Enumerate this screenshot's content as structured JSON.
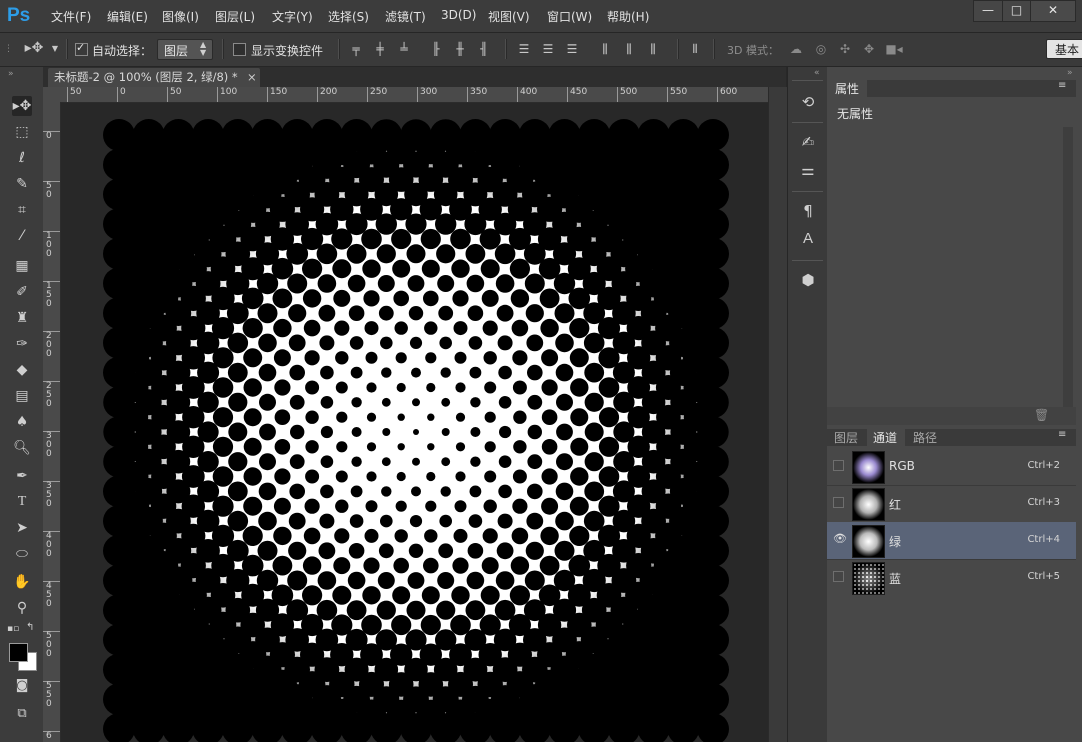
{
  "app": {
    "logo": "Ps"
  },
  "menu": [
    "文件(F)",
    "编辑(E)",
    "图像(I)",
    "图层(L)",
    "文字(Y)",
    "选择(S)",
    "滤镜(T)",
    "3D(D)",
    "视图(V)",
    "窗口(W)",
    "帮助(H)"
  ],
  "window_controls": {
    "minimize": "—",
    "restore": "□",
    "close": "✕"
  },
  "options": {
    "auto_select_label": "自动选择：",
    "auto_select_target": "图层",
    "show_transform_label": "显示变换控件",
    "mode_3d_label": "3D 模式：",
    "workspace_button": "基本"
  },
  "document": {
    "tab_title": "未标题-2 @ 100% (图层 2, 绿/8) *",
    "close": "×"
  },
  "rulers": {
    "horizontal": [
      "50",
      "0",
      "50",
      "100",
      "150",
      "200",
      "250",
      "300",
      "350",
      "400",
      "450",
      "500",
      "550",
      "600"
    ],
    "vertical": [
      "0",
      "5 0",
      "1 0 0",
      "1 5 0",
      "2 0 0",
      "2 5 0",
      "3 0 0",
      "3 5 0",
      "4 0 0",
      "4 5 0",
      "5 0 0",
      "5 5 0",
      "6"
    ]
  },
  "properties_panel": {
    "tab": "属性",
    "content": "无属性"
  },
  "channels_panel": {
    "tabs": [
      "图层",
      "通道",
      "路径"
    ],
    "active_tab_index": 1,
    "channels": [
      {
        "name": "RGB",
        "shortcut": "Ctrl+2",
        "visible": false,
        "selected": false
      },
      {
        "name": "红",
        "shortcut": "Ctrl+3",
        "visible": false,
        "selected": false
      },
      {
        "name": "绿",
        "shortcut": "Ctrl+4",
        "visible": true,
        "selected": true
      },
      {
        "name": "蓝",
        "shortcut": "Ctrl+5",
        "visible": false,
        "selected": false
      }
    ]
  },
  "colors": {
    "brand": "#2d9de8",
    "selected_row": "#5a6478",
    "foreground": "#000000",
    "background": "#ffffff"
  },
  "icons": {
    "toolbox": [
      "move-tool",
      "marquee-tool",
      "lasso-tool",
      "quick-select-tool",
      "crop-tool",
      "eyedropper-tool",
      "healing-brush-tool",
      "brush-tool",
      "clone-stamp-tool",
      "history-brush-tool",
      "eraser-tool",
      "gradient-tool",
      "blur-tool",
      "dodge-tool",
      "pen-tool",
      "type-tool",
      "path-select-tool",
      "shape-tool",
      "hand-tool",
      "zoom-tool"
    ],
    "dock": [
      "history-icon",
      "brushes-icon",
      "adjust-icon",
      "paragraph-icon",
      "character-icon",
      "3d-icon"
    ]
  }
}
